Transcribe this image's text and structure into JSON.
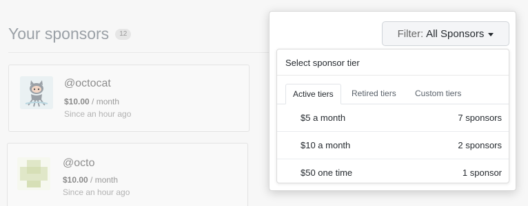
{
  "page": {
    "title": "Your sponsors",
    "count_badge": "12"
  },
  "sponsors": [
    {
      "login": "@octocat",
      "amount": "$10.00",
      "period": " / month",
      "since": "Since an hour ago",
      "avatar_icon": "octocat-icon"
    },
    {
      "login": "@octo",
      "amount": "$10.00",
      "period": " / month",
      "since": "Since an hour ago",
      "avatar_icon": "identicon"
    }
  ],
  "filter": {
    "label": "Filter:",
    "value": "All Sponsors"
  },
  "menu": {
    "header": "Select sponsor tier",
    "tabs": [
      {
        "label": "Active tiers",
        "selected": true
      },
      {
        "label": "Retired tiers",
        "selected": false
      },
      {
        "label": "Custom tiers",
        "selected": false
      }
    ],
    "tiers": [
      {
        "name": "$5 a month",
        "count": "7 sponsors"
      },
      {
        "name": "$10 a month",
        "count": "2 sponsors"
      },
      {
        "name": "$50 one time",
        "count": "1 sponsor"
      }
    ]
  }
}
